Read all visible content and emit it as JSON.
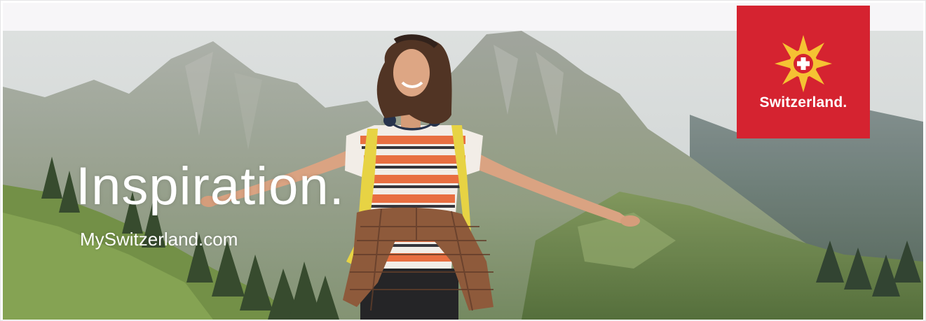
{
  "banner": {
    "headline": "Inspiration.",
    "website": "MySwitzerland.com",
    "brand": {
      "name": "Switzerland.",
      "logo_icon": "swiss-flower-cross-logo",
      "background_color": "#d52330",
      "flower_color": "#f5c233",
      "cross_color": "#ffffff"
    },
    "image_subject": "hiker-woman-arms-outstretched-mountains"
  }
}
